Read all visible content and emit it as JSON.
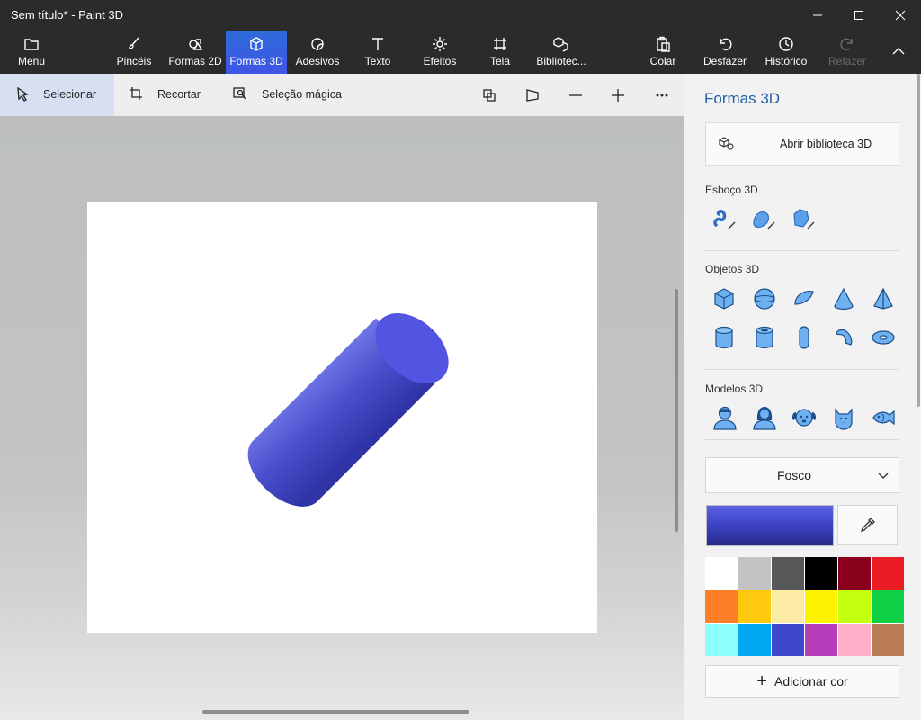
{
  "window": {
    "title": "Sem título* - Paint 3D"
  },
  "ribbon": {
    "menu": "Menu",
    "tabs": [
      {
        "label": "Pincéis",
        "icon": "brush-icon"
      },
      {
        "label": "Formas 2D",
        "icon": "shapes-2d-icon"
      },
      {
        "label": "Formas 3D",
        "icon": "cube-icon",
        "active": true
      },
      {
        "label": "Adesivos",
        "icon": "sticker-icon"
      },
      {
        "label": "Texto",
        "icon": "text-icon"
      },
      {
        "label": "Efeitos",
        "icon": "sun-icon"
      },
      {
        "label": "Tela",
        "icon": "canvas-icon"
      },
      {
        "label": "Bibliotec...",
        "icon": "library-icon"
      }
    ],
    "actions": {
      "paste": "Colar",
      "undo": "Desfazer",
      "history": "Histórico",
      "redo": "Refazer"
    }
  },
  "toolbar": {
    "select": "Selecionar",
    "crop": "Recortar",
    "magic_select": "Seleção mágica"
  },
  "panel": {
    "title": "Formas 3D",
    "library_button": "Abrir biblioteca 3D",
    "sketch_label": "Esboço 3D",
    "objects_label": "Objetos 3D",
    "models_label": "Modelos 3D",
    "material": "Fosco",
    "add_color": "Adicionar cor",
    "selected_color": "#3f45c8",
    "palette": [
      "#ffffff",
      "#c3c3c3",
      "#585858",
      "#000000",
      "#88001b",
      "#ec1c24",
      "#ff7f27",
      "#ffc90e",
      "#fdeca6",
      "#fff200",
      "#c4ff0e",
      "#0ed145",
      "#8cfffb",
      "#00a8f3",
      "#3f48cc",
      "#b83dba",
      "#ffaec8",
      "#b97a56"
    ]
  }
}
